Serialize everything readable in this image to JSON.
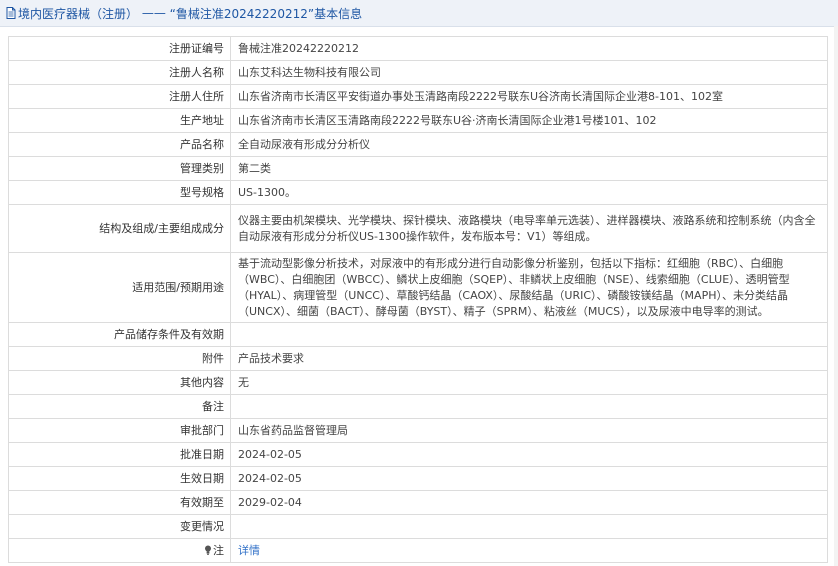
{
  "header": {
    "title_prefix": "境内医疗器械（注册）",
    "separator": " —— ",
    "title_main": "“鲁械注准20242220212”基本信息"
  },
  "rows": [
    {
      "label": "注册证编号",
      "value": "鲁械注准20242220212"
    },
    {
      "label": "注册人名称",
      "value": "山东艾科达生物科技有限公司"
    },
    {
      "label": "注册人住所",
      "value": "山东省济南市长清区平安街道办事处玉清路南段2222号联东U谷济南长清国际企业港8-101、102室"
    },
    {
      "label": "生产地址",
      "value": "山东省济南市长清区玉清路南段2222号联东U谷·济南长清国际企业港1号楼101、102"
    },
    {
      "label": "产品名称",
      "value": "全自动尿液有形成分分析仪"
    },
    {
      "label": "管理类别",
      "value": "第二类"
    },
    {
      "label": "型号规格",
      "value": "US-1300。"
    },
    {
      "label": "结构及组成/主要组成成分",
      "value": "仪器主要由机架模块、光学模块、探针模块、液路模块（电导率单元选装）、进样器模块、液路系统和控制系统（内含全自动尿液有形成分分析仪US-1300操作软件，发布版本号：V1）等组成。"
    },
    {
      "label": "适用范围/预期用途",
      "value": "基于流动型影像分析技术，对尿液中的有形成分进行自动影像分析鉴别，包括以下指标：红细胞（RBC）、白细胞（WBC）、白细胞团（WBCC）、鳞状上皮细胞（SQEP）、非鳞状上皮细胞（NSE）、线索细胞（CLUE）、透明管型（HYAL）、病理管型（UNCC）、草酸钙结晶（CAOX）、尿酸结晶（URIC）、磷酸铵镁结晶（MAPH）、未分类结晶（UNCX）、细菌（BACT）、酵母菌（BYST）、精子（SPRM）、粘液丝（MUCS），以及尿液中电导率的测试。"
    },
    {
      "label": "产品储存条件及有效期",
      "value": ""
    },
    {
      "label": "附件",
      "value": "产品技术要求"
    },
    {
      "label": "其他内容",
      "value": "无"
    },
    {
      "label": "备注",
      "value": ""
    },
    {
      "label": "审批部门",
      "value": "山东省药品监督管理局"
    },
    {
      "label": "批准日期",
      "value": "2024-02-05"
    },
    {
      "label": "生效日期",
      "value": "2024-02-05"
    },
    {
      "label": "有效期至",
      "value": "2029-02-04"
    },
    {
      "label": "变更情况",
      "value": ""
    }
  ],
  "note_row": {
    "label": "注",
    "link_text": "详情",
    "icon": "lamp-icon"
  },
  "colors": {
    "header_bg": "#eef2f8",
    "header_text": "#1f57a4",
    "link": "#2f6fc7",
    "border": "#dcdcdc"
  }
}
